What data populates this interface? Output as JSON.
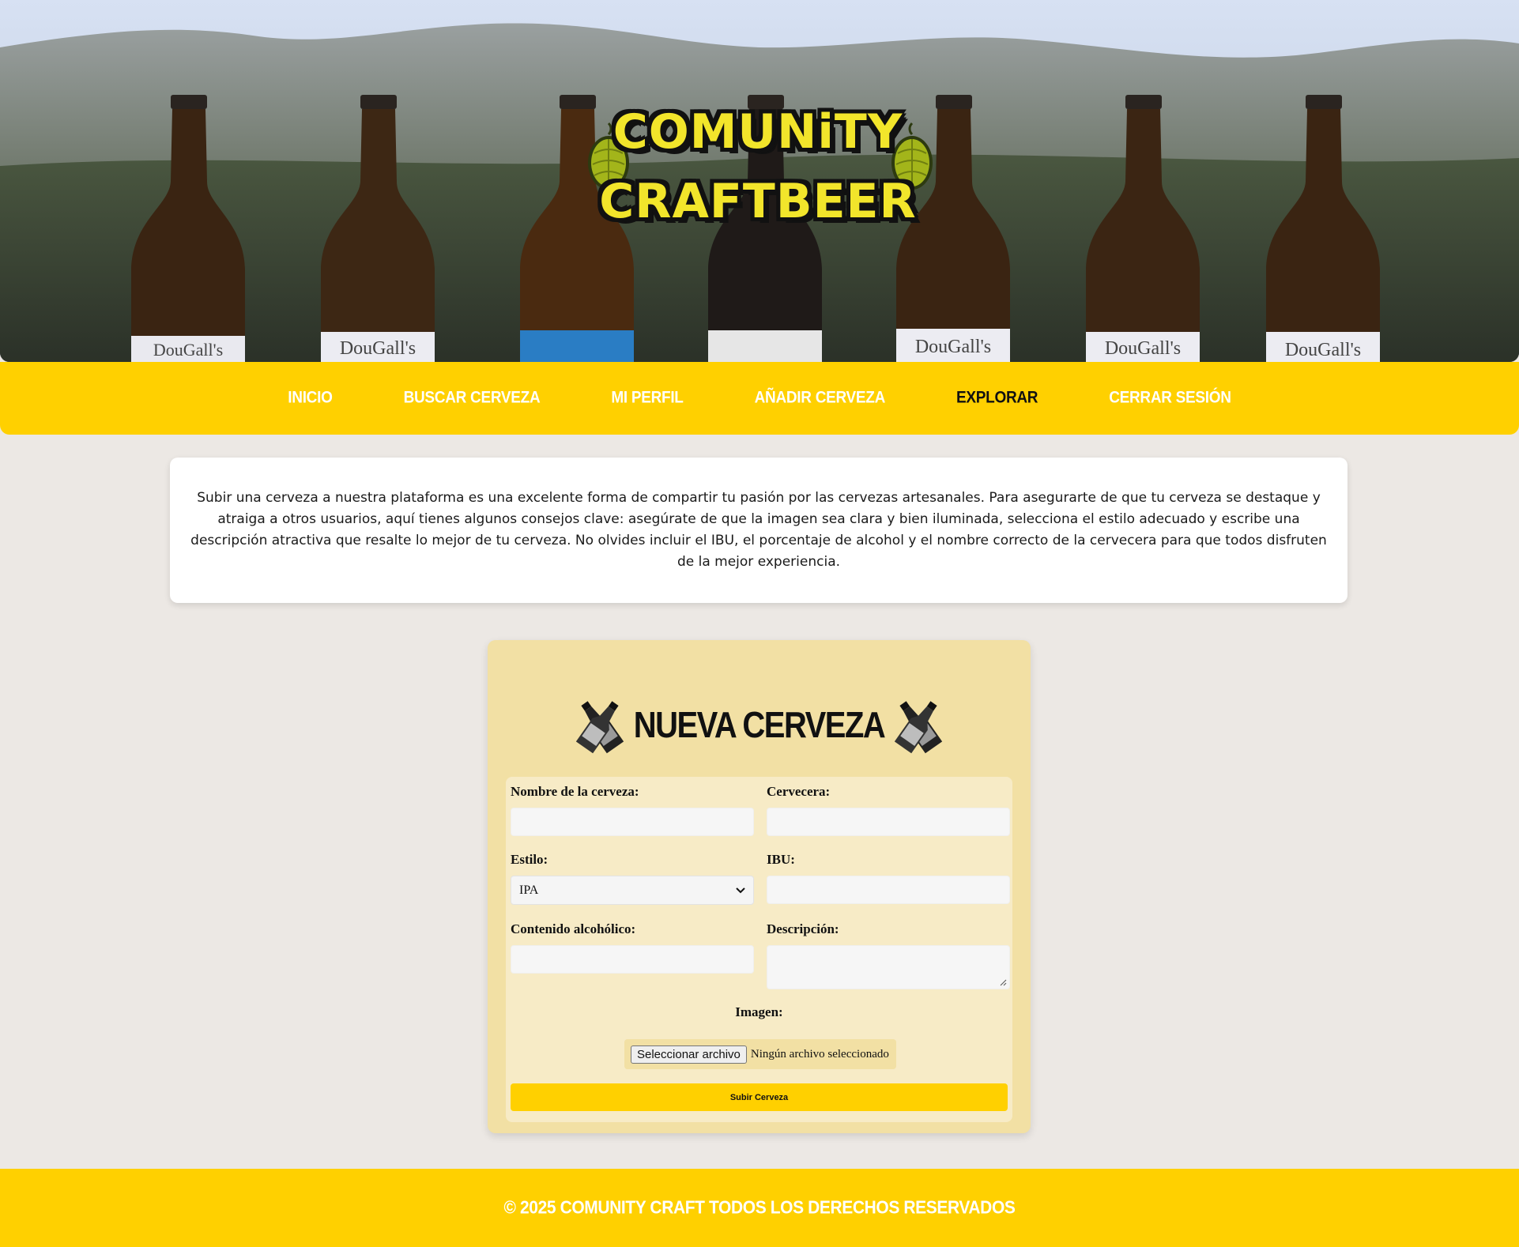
{
  "brand": {
    "line1": "COMUNiTY",
    "line2": "CRAFTBEER",
    "bottle_label": "DouGall's"
  },
  "nav": {
    "items": [
      {
        "label": "INICIO",
        "active": false
      },
      {
        "label": "BUSCAR CERVEZA",
        "active": false
      },
      {
        "label": "MI PERFIL",
        "active": false
      },
      {
        "label": "AÑADIR CERVEZA",
        "active": false
      },
      {
        "label": "EXPLORAR",
        "active": true
      },
      {
        "label": "CERRAR SESIÓN",
        "active": false
      }
    ]
  },
  "info": {
    "text": "Subir una cerveza a nuestra plataforma es una excelente forma de compartir tu pasión por las cervezas artesanales. Para asegurarte de que tu cerveza se destaque y atraiga a otros usuarios, aquí tienes algunos consejos clave: asegúrate de que la imagen sea clara y bien iluminada, selecciona el estilo adecuado y escribe una descripción atractiva que resalte lo mejor de tu cerveza. No olvides incluir el IBU, el porcentaje de alcohol y el nombre correcto de la cervecera para que todos disfruten de la mejor experiencia."
  },
  "form": {
    "title": "NUEVA CERVEZA",
    "fields": {
      "nombre": {
        "label": "Nombre de la cerveza:",
        "value": ""
      },
      "cervecera": {
        "label": "Cervecera:",
        "value": ""
      },
      "estilo": {
        "label": "Estilo:",
        "value": "IPA"
      },
      "ibu": {
        "label": "IBU:",
        "value": ""
      },
      "alcohol": {
        "label": "Contenido alcohólico:",
        "value": ""
      },
      "descripcion": {
        "label": "Descripción:",
        "value": ""
      }
    },
    "image": {
      "label": "Imagen:",
      "button": "Seleccionar archivo",
      "status": "Ningún archivo seleccionado"
    },
    "submit": "Subir Cerveza"
  },
  "footer": {
    "text": "© 2025 COMUNITY CRAFT TODOS LOS DERECHOS RESERVADOS"
  },
  "colors": {
    "accent": "#ffd000",
    "page_bg": "#ece8e4",
    "form_bg": "#f2e0a4",
    "form_inner_bg": "#f7ebc6",
    "logo_yellow": "#f2e52b"
  },
  "icons": [
    "hop-icon",
    "crossed-bottles-icon",
    "chevron-down-icon",
    "resize-grip-icon"
  ]
}
